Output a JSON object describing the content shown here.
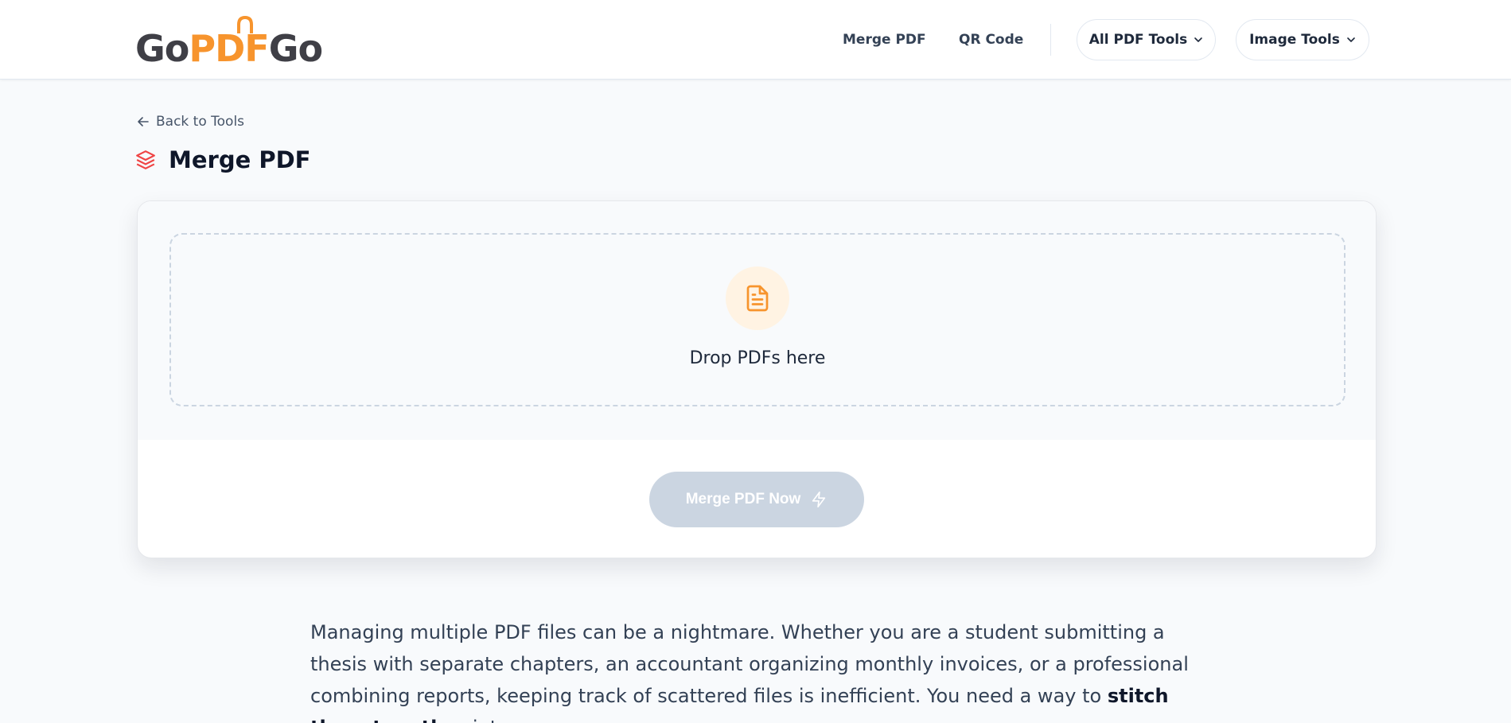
{
  "header": {
    "logo": {
      "part1": "Go",
      "part2": "PDF",
      "part3": "Go"
    },
    "nav": {
      "merge_pdf": "Merge PDF",
      "qr_code": "QR Code",
      "all_pdf_tools": "All PDF Tools",
      "image_tools": "Image Tools"
    }
  },
  "page": {
    "back_label": "Back to Tools",
    "title": "Merge PDF"
  },
  "upload": {
    "drop_text": "Drop PDFs here",
    "button_label": "Merge PDF Now"
  },
  "description": {
    "text_before": "Managing multiple PDF files can be a nightmare. Whether you are a student submitting a thesis with separate chapters, an accountant organizing monthly invoices, or a professional combining reports, keeping track of scattered files is inefficient. You need a way to ",
    "emphasis": "stitch them together",
    "text_after": " into"
  },
  "colors": {
    "brand_orange": "#f7942d",
    "logo_dark": "#3f3f46",
    "title_icon_red": "#ef4444",
    "button_disabled": "#cbd5e1",
    "page_bg": "#f8fafc"
  },
  "icons": {
    "back": "arrow-left-icon",
    "title": "layers-icon",
    "dropzone": "file-text-icon",
    "button": "zap-icon",
    "dropdown": "chevron-down-icon"
  }
}
